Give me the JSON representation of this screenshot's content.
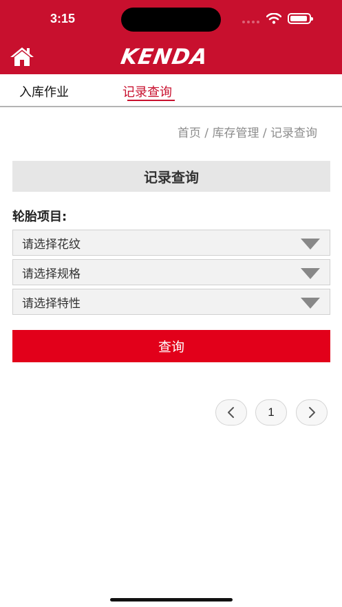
{
  "status_bar": {
    "time": "3:15"
  },
  "header": {
    "brand": "KENDA",
    "home_icon": "home-icon"
  },
  "tabs": [
    {
      "label": "入库作业",
      "active": false
    },
    {
      "label": "记录查询",
      "active": true
    }
  ],
  "breadcrumb": {
    "items": [
      "首页",
      "库存管理",
      "记录查询"
    ],
    "separator": " / "
  },
  "panel": {
    "title": "记录查询"
  },
  "form": {
    "label": "轮胎项目:",
    "selects": [
      {
        "placeholder": "请选择花纹"
      },
      {
        "placeholder": "请选择规格"
      },
      {
        "placeholder": "请选择特性"
      }
    ],
    "submit_label": "查询"
  },
  "pagination": {
    "current_page": "1"
  },
  "colors": {
    "brand_red": "#c8102e",
    "button_red": "#e2001a",
    "panel_gray": "#e6e6e6"
  }
}
